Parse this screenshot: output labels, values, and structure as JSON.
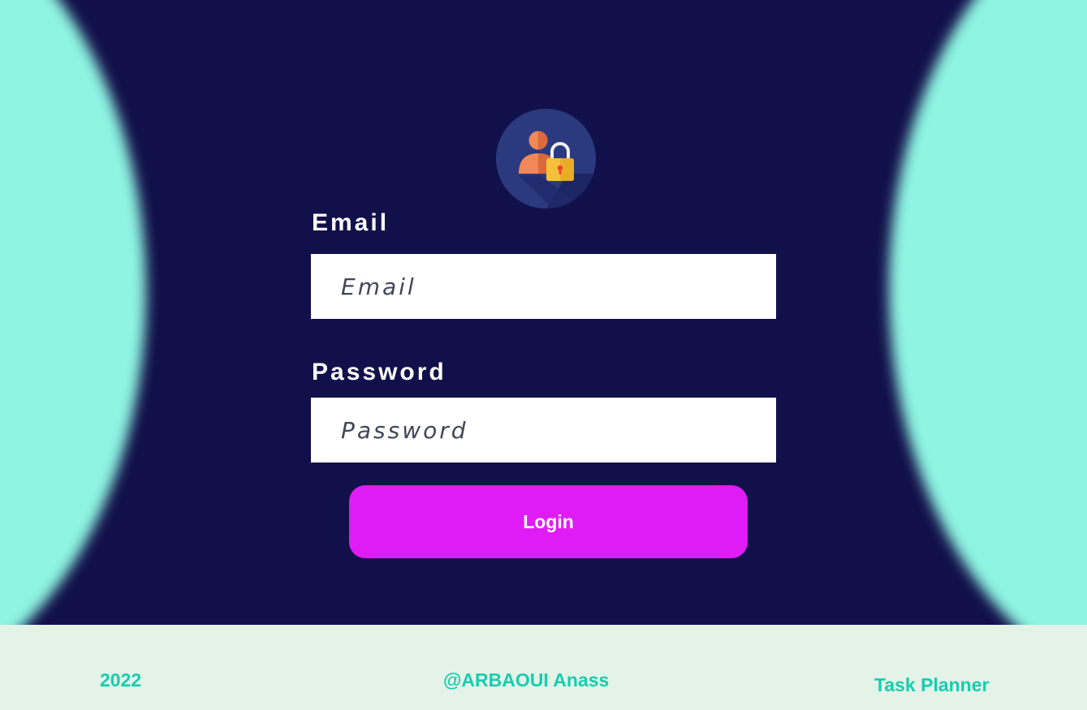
{
  "login_form": {
    "email": {
      "label": "Email",
      "placeholder": "Email"
    },
    "password": {
      "label": "Password",
      "placeholder": "Password"
    },
    "login_button_label": "Login"
  },
  "icons": {
    "avatar": "user-lock-icon"
  },
  "footer": {
    "year": "2022",
    "author": "@ARBAOUI Anass",
    "app_name": "Task Planner"
  },
  "colors": {
    "background": "#12104a",
    "accent_blob": "#8ff5e2",
    "button": "#e01cf6",
    "footer_background": "#e3f3e8",
    "footer_text": "#18cdae"
  }
}
